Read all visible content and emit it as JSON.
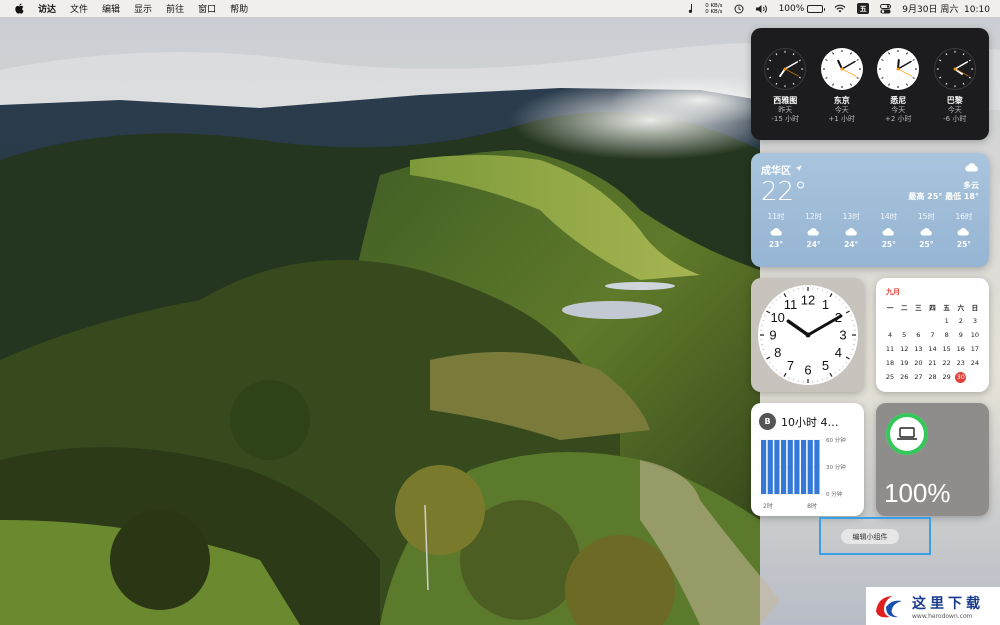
{
  "menubar": {
    "apple_icon": "apple-logo-icon",
    "app_name": "访达",
    "menus": [
      "文件",
      "编辑",
      "显示",
      "前往",
      "窗口",
      "帮助"
    ],
    "net_up": "0 KB/s",
    "net_down": "0 KB/s",
    "battery_percent": "100%",
    "datetime": "9月30日 周六  10:10",
    "status_icons": [
      "music-icon",
      "time-machine-icon",
      "volume-icon",
      "battery-icon",
      "wifi-icon",
      "stocks-icon",
      "control-center-icon"
    ]
  },
  "world_clock": {
    "cities": [
      {
        "name": "西雅图",
        "day": "昨天",
        "offset": "-15 小时",
        "face": "dark",
        "hour": 19,
        "minute": 10
      },
      {
        "name": "东京",
        "day": "今天",
        "offset": "+1 小时",
        "face": "light",
        "hour": 11,
        "minute": 10
      },
      {
        "name": "悉尼",
        "day": "今天",
        "offset": "+2 小时",
        "face": "light",
        "hour": 12,
        "minute": 10
      },
      {
        "name": "巴黎",
        "day": "今天",
        "offset": "-6 小时",
        "face": "dark",
        "hour": 4,
        "minute": 10
      }
    ]
  },
  "weather": {
    "location": "成华区",
    "temp": "22°",
    "condition": "多云",
    "hilo": "最高 25° 最低 18°",
    "hours": [
      {
        "label": "11时",
        "temp": "23°"
      },
      {
        "label": "12时",
        "temp": "24°"
      },
      {
        "label": "13时",
        "temp": "24°"
      },
      {
        "label": "14时",
        "temp": "25°"
      },
      {
        "label": "15时",
        "temp": "25°"
      },
      {
        "label": "16时",
        "temp": "25°"
      }
    ]
  },
  "analog_clock": {
    "numbers": [
      "12",
      "1",
      "2",
      "3",
      "4",
      "5",
      "6",
      "7",
      "8",
      "9",
      "10",
      "11"
    ],
    "hour": 10,
    "minute": 10
  },
  "calendar": {
    "month": "九月",
    "weekdays": [
      "一",
      "二",
      "三",
      "四",
      "五",
      "六",
      "日"
    ],
    "leading_blanks": 4,
    "days": [
      "1",
      "2",
      "3",
      "4",
      "5",
      "6",
      "7",
      "8",
      "9",
      "10",
      "11",
      "12",
      "13",
      "14",
      "15",
      "16",
      "17",
      "18",
      "19",
      "20",
      "21",
      "22",
      "23",
      "24",
      "25",
      "26",
      "27",
      "28",
      "29",
      "30"
    ],
    "today": "30"
  },
  "screen_time": {
    "avatar": "B",
    "total": "10小时 4…",
    "y_labels": [
      "60 分钟",
      "30 分钟",
      "0 分钟"
    ],
    "x_labels": [
      "2时",
      "8时"
    ],
    "bar_minutes": [
      60,
      60,
      60,
      60,
      60,
      60,
      60,
      60,
      60
    ]
  },
  "battery_widget": {
    "device_icon": "laptop-icon",
    "percent": "100%",
    "level": 1.0
  },
  "edit_widgets": {
    "label": "编辑小组件"
  },
  "watermark": {
    "title": "这里下载",
    "url": "www.herodown.com"
  },
  "colors": {
    "accent_red": "#e0403a",
    "battery_green": "#34c759",
    "screentime_blue": "#3478d8",
    "highlight_blue": "#3aa0e6"
  }
}
